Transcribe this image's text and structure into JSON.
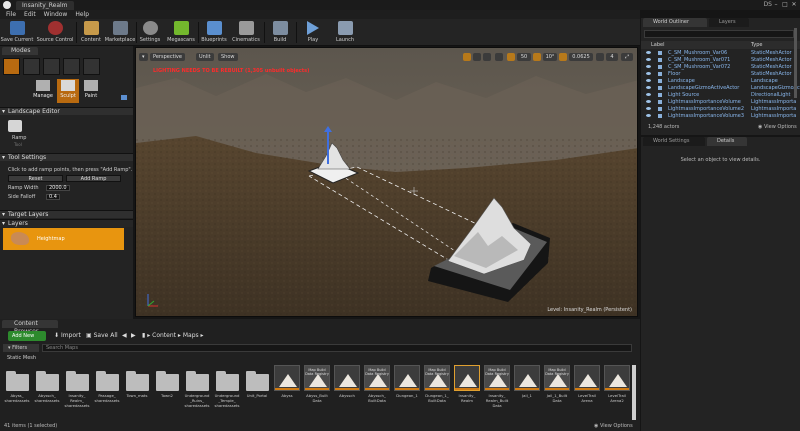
{
  "window": {
    "title_tab": "Insanity_Realm",
    "user_initials": "DS",
    "controls": [
      "–",
      "□",
      "✕"
    ]
  },
  "menu": [
    "File",
    "Edit",
    "Window",
    "Help"
  ],
  "toolbar": [
    {
      "label": "Save Current",
      "icon": "save-icon",
      "color": "#3d6fb0"
    },
    {
      "label": "Source Control",
      "icon": "source-control-icon",
      "color": "#a03030"
    },
    {
      "label": "Content",
      "icon": "content-icon",
      "color": "#c79a4a"
    },
    {
      "label": "Marketplace",
      "icon": "marketplace-icon",
      "color": "#6d7a8a"
    },
    {
      "label": "Settings",
      "icon": "settings-icon",
      "color": "#8a8a8a"
    },
    {
      "label": "Megascans",
      "icon": "megascans-icon",
      "color": "#73b82d"
    },
    {
      "label": "Blueprints",
      "icon": "blueprints-icon",
      "color": "#5a8fcf"
    },
    {
      "label": "Cinematics",
      "icon": "cinematics-icon",
      "color": "#9a9a9a"
    },
    {
      "label": "Build",
      "icon": "build-icon",
      "color": "#7d8da0"
    },
    {
      "label": "Play",
      "icon": "play-icon",
      "color": "#6fa0d8"
    },
    {
      "label": "Launch",
      "icon": "launch-icon",
      "color": "#8a9bb0"
    }
  ],
  "modes": {
    "tab_label": "Modes",
    "submodes": [
      {
        "label": "Manage",
        "icon": "manage-icon"
      },
      {
        "label": "Sculpt",
        "icon": "sculpt-icon"
      },
      {
        "label": "Paint",
        "icon": "paint-icon"
      }
    ],
    "landscape_editor_header": "Landscape Editor",
    "tool": {
      "label": "Ramp",
      "sub": "Tool"
    },
    "tool_settings_header": "Tool Settings",
    "instruction": "Click to add ramp points, then press \"Add Ramp\".",
    "reset_label": "Reset",
    "add_ramp_label": "Add Ramp",
    "ramp_width_label": "Ramp Width",
    "ramp_width_value": "2000.0",
    "side_falloff_label": "Side Falloff",
    "side_falloff_value": "0.4",
    "target_layers_header": "Target Layers",
    "layers_header": "Layers",
    "layer_name": "Heightmap"
  },
  "viewport": {
    "perspective_label": "Perspective",
    "lit_label": "Unlit",
    "show_label": "Show",
    "warning": "LIGHTING NEEDS TO BE REBUILT (1,305 unbuilt objects)",
    "grid_snap": "50",
    "rotation_snap": "10°",
    "scale_snap": "0.0625",
    "camera_speed": "4",
    "level_label": "Level:  Insanity_Realm (Persistent)"
  },
  "content_browser": {
    "tab_label": "Content Browser",
    "add_new_label": "Add New",
    "import_label": "Import",
    "save_all_label": "Save All",
    "crumbs": [
      "Content",
      "Maps"
    ],
    "filters_label": "Filters",
    "search_placeholder": "Search Maps",
    "static_mesh_label": "Static Mesh",
    "assets": [
      {
        "name": "Abyss_ sharedassets",
        "kind": "folder"
      },
      {
        "name": "Abyssch_ sharedassets",
        "kind": "folder"
      },
      {
        "name": "Insanity_ Realm_ sharedassets",
        "kind": "folder"
      },
      {
        "name": "Passage_ sharedassets",
        "kind": "folder"
      },
      {
        "name": "Town_mats",
        "kind": "folder"
      },
      {
        "name": "Town2",
        "kind": "folder"
      },
      {
        "name": "Underground _Ruins_ sharedassets",
        "kind": "folder"
      },
      {
        "name": "Underground _Temple_ sharedassets",
        "kind": "folder"
      },
      {
        "name": "Unit_Portal",
        "kind": "folder"
      },
      {
        "name": "Abyss",
        "kind": "map"
      },
      {
        "name": "Abyss_Built Data",
        "kind": "data",
        "tag": "Map Build Data Registry"
      },
      {
        "name": "Abyssch",
        "kind": "map"
      },
      {
        "name": "Abyssch_ BuiltData",
        "kind": "data",
        "tag": "Map Build Data Registry"
      },
      {
        "name": "Dungeon_1",
        "kind": "map"
      },
      {
        "name": "Dungeon_1_ BuiltData",
        "kind": "data",
        "tag": "Map Build Data Registry"
      },
      {
        "name": "Insanity_ Realm",
        "kind": "map",
        "selected": true
      },
      {
        "name": "Insanity_ Realm_Built Data",
        "kind": "data",
        "tag": "Map Build Data Registry"
      },
      {
        "name": "Jail_1",
        "kind": "map"
      },
      {
        "name": "Jail_1_Built Data",
        "kind": "data",
        "tag": "Map Build Data Registry"
      },
      {
        "name": "LevelTrail Arena",
        "kind": "map"
      },
      {
        "name": "LevelTrail Arena2",
        "kind": "map"
      }
    ],
    "status": "41 items (1 selected)",
    "view_options": "View Options"
  },
  "outliner": {
    "tab_label": "World Outliner",
    "layers_tab": "Layers",
    "col_label": "Label",
    "col_type": "Type",
    "rows": [
      {
        "label": "C_SM_Mushroom_Var06",
        "type": "StaticMeshActor"
      },
      {
        "label": "C_SM_Mushroom_Var071",
        "type": "StaticMeshActor"
      },
      {
        "label": "C_SM_Mushroom_Var072",
        "type": "StaticMeshActor"
      },
      {
        "label": "Floor",
        "type": "StaticMeshActor"
      },
      {
        "label": "Landscape",
        "type": "Landscape"
      },
      {
        "label": "LandscapeGizmoActiveActor",
        "type": "LandscapeGizmoActor"
      },
      {
        "label": "Light Source",
        "type": "DirectionalLight"
      },
      {
        "label": "LightmassImportanceVolume",
        "type": "LightmassImporta"
      },
      {
        "label": "LightmassImportanceVolume2",
        "type": "LightmassImporta"
      },
      {
        "label": "LightmassImportanceVolume3",
        "type": "LightmassImporta"
      }
    ],
    "actors": "1,248 actors",
    "view_options": "View Options"
  },
  "details": {
    "world_settings_tab": "World Settings",
    "details_tab": "Details",
    "message": "Select an object to view details."
  }
}
